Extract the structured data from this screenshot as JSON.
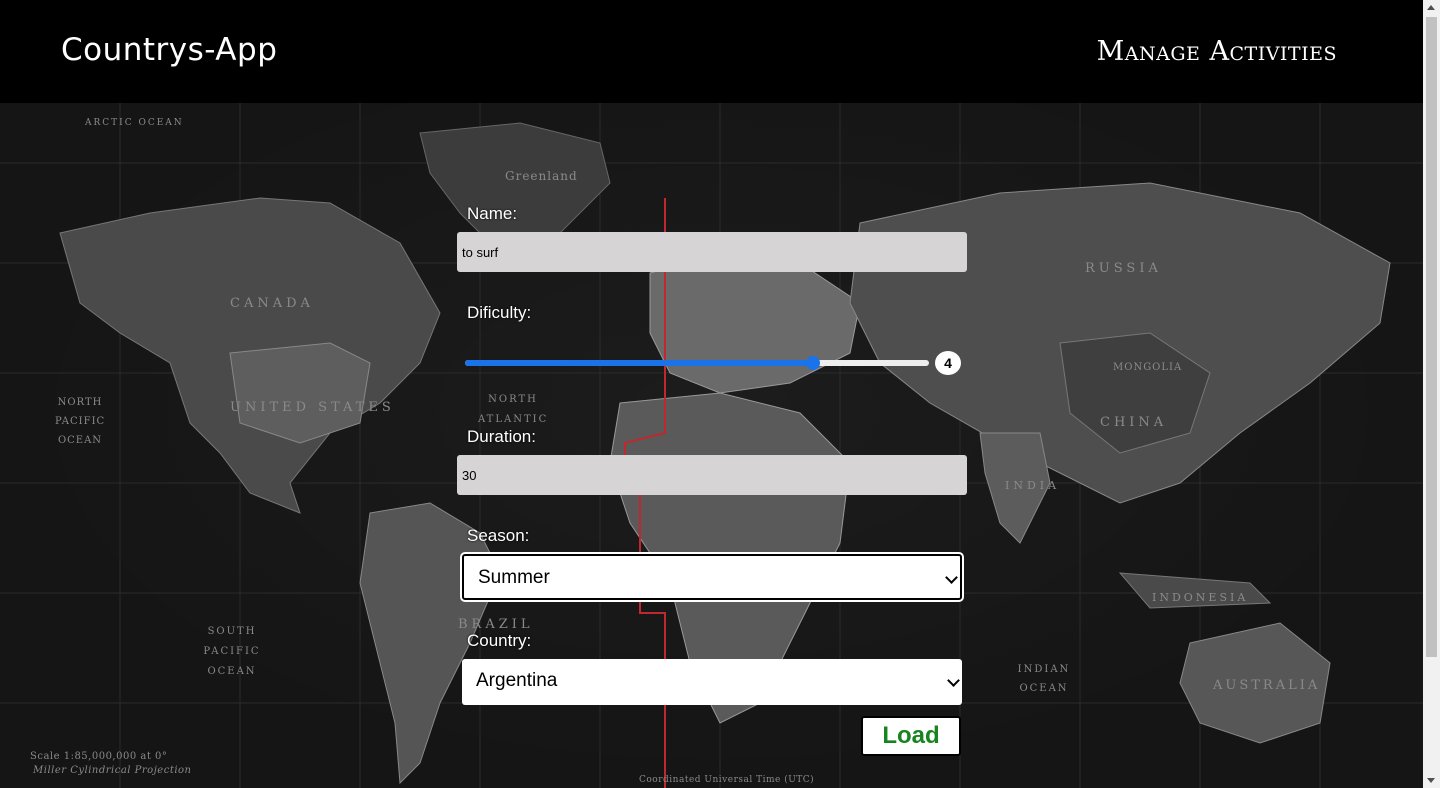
{
  "app": {
    "brand": "Countrys-App",
    "nav_link": "Manage Activities"
  },
  "map": {
    "labels": {
      "greenland": "Greenland",
      "canada": "CANADA",
      "united_states": "UNITED STATES",
      "russia": "RUSSIA",
      "china": "CHINA",
      "india": "INDIA",
      "brazil": "BRAZIL",
      "australia": "AUSTRALIA",
      "indonesia": "INDONESIA",
      "mongolia": "MONGOLIA",
      "north_pacific_ocean": "NORTH PACIFIC OCEAN",
      "south_pacific_ocean": "SOUTH PACIFIC OCEAN",
      "indian_ocean": "INDIAN OCEAN",
      "north_atlantic": "NORTH ATLANTIC",
      "arctic_ocean": "ARCTIC OCEAN",
      "scale": "Scale 1:85,000,000 at 0°",
      "projection": "Miller Cylindrical Projection",
      "utc": "Coordinated Universal Time (UTC)"
    }
  },
  "form": {
    "name_label": "Name:",
    "name_value": "to surf",
    "difficulty_label": "Dificulty:",
    "difficulty_value": "4",
    "difficulty_fraction": 0.75,
    "duration_label": "Duration:",
    "duration_value": "30",
    "season_label": "Season:",
    "season_value": "Summer",
    "country_label": "Country:",
    "country_value": "Argentina",
    "load_label": "Load"
  }
}
